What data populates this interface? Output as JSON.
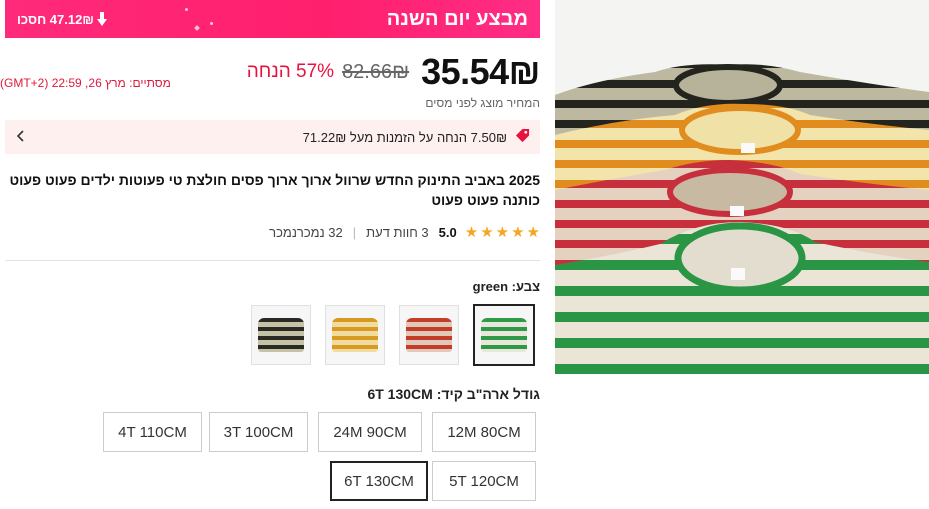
{
  "banner": {
    "title": "מבצע יום השנה",
    "saved_label": "47.12₪ חסכו"
  },
  "price": {
    "current": "35.54₪",
    "original": "82.66₪",
    "discount": "57% הנחה",
    "tax_note": "המחיר מוצג לפני מסים",
    "timer": "מסתיים: מרץ 26, 22:59 (GMT+2)"
  },
  "promo": {
    "text": "7.50₪ הנחה על הזמנות מעל 71.22₪"
  },
  "product": {
    "title": "2025 באביב התינוק החדש שרוול ארוך ארוך פסים חולצת טי פעוטות ילדים פעוט פעוט כותנה פעוט פעוט"
  },
  "rating": {
    "score": "5.0",
    "reviews": "3 חוות דעת",
    "sold": "32 נמכרנמכר"
  },
  "color": {
    "label": "צבע:",
    "selected": "green"
  },
  "thumbnails": [
    {
      "name": "green",
      "colors": [
        "#e9e6dc",
        "#2e9a48"
      ]
    },
    {
      "name": "red",
      "colors": [
        "#e0c9b8",
        "#c33d2a"
      ]
    },
    {
      "name": "yellow",
      "colors": [
        "#f0dca0",
        "#d99a24"
      ]
    },
    {
      "name": "black",
      "colors": [
        "#c6c2a5",
        "#2a2a24"
      ]
    }
  ],
  "size": {
    "label": "גודל ארה\"ב קיד:",
    "selected": "6T 130CM"
  },
  "sizes": [
    "12M 80CM",
    "24M 90CM",
    "3T 100CM",
    "4T 110CM",
    "5T 120CM",
    "6T 130CM"
  ],
  "colors": {
    "accent": "#ff1f6d",
    "discount": "#e8113f",
    "promo_bg": "#fff0f0",
    "star": "#f5a623"
  }
}
